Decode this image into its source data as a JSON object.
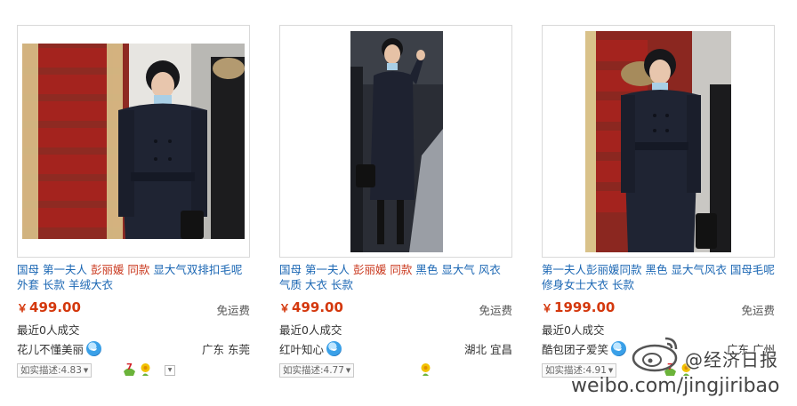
{
  "products": [
    {
      "title_parts": [
        {
          "text": "国母 第一夫人 ",
          "hl": false
        },
        {
          "text": "彭丽媛 同款",
          "hl": true
        },
        {
          "text": " 显大气双排扣毛呢外套 长款 羊绒大衣",
          "hl": false
        }
      ],
      "currency": "￥",
      "price": "499.00",
      "shipping": "免运费",
      "sold": "最近0人成交",
      "seller": "花儿不懂美丽",
      "location": "广东 东莞",
      "rating": "如实描述:4.83"
    },
    {
      "title_parts": [
        {
          "text": "国母 第一夫人 ",
          "hl": false
        },
        {
          "text": "彭丽媛 同款",
          "hl": true
        },
        {
          "text": " 黑色 显大气 风衣 气质 大衣 长款",
          "hl": false
        }
      ],
      "currency": "￥",
      "price": "499.00",
      "shipping": "免运费",
      "sold": "最近0人成交",
      "seller": "红叶知心",
      "location": "湖北 宜昌",
      "rating": "如实描述:4.77"
    },
    {
      "title_parts": [
        {
          "text": "第一夫人彭丽媛同款 黑色 显大气风衣 国母毛呢修身女士大衣 长款",
          "hl": false
        }
      ],
      "currency": "￥",
      "price": "1999.00",
      "shipping": "免运费",
      "sold": "最近0人成交",
      "seller": "酷包团子爱笑",
      "location": "广东 广州",
      "rating": "如实描述:4.91"
    }
  ],
  "watermark": {
    "handle": "@经济日报",
    "url": "weibo.com/jingjiribao"
  },
  "colors": {
    "link": "#1a66b3",
    "highlight": "#c9361b",
    "price": "#d4380d",
    "coat": "#1f2433",
    "carpet": "#a4231e"
  }
}
